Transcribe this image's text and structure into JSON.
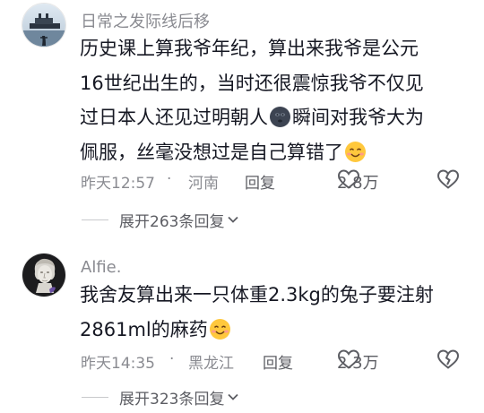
{
  "comments": [
    {
      "username": "日常之发际线后移",
      "lines": [
        "历史课上算我爷年纪，算出来我爷是公元",
        "16世纪出生的，当时还很震惊我爷不仅见"
      ],
      "line3_before": "过日本人还见过明朝人",
      "line3_after": "瞬间对我爷大为",
      "line4": "佩服，丝毫没想过是自己算错了",
      "time": "昨天12:57",
      "dot": "·",
      "location": "河南",
      "reply": "回复",
      "likes": "2.8万",
      "expand": "展开263条回复"
    },
    {
      "username": "Alfie.",
      "lines": [
        "我舍友算出来一只体重2.3kg的兔子要注射"
      ],
      "line2": "2861ml的麻药",
      "time": "昨天14:35",
      "dot": "·",
      "location": "黑龙江",
      "reply": "回复",
      "likes": "2.3万",
      "expand": "展开323条回复"
    }
  ],
  "colors": {
    "text": "#161823",
    "secondary": "#8a8b91",
    "action": "#5c5d63"
  },
  "icons": [
    "ship-avatar",
    "bust-avatar",
    "dark-face-emoji",
    "smile-emoji",
    "heart-icon",
    "broken-heart-icon",
    "chevron-down-icon"
  ]
}
